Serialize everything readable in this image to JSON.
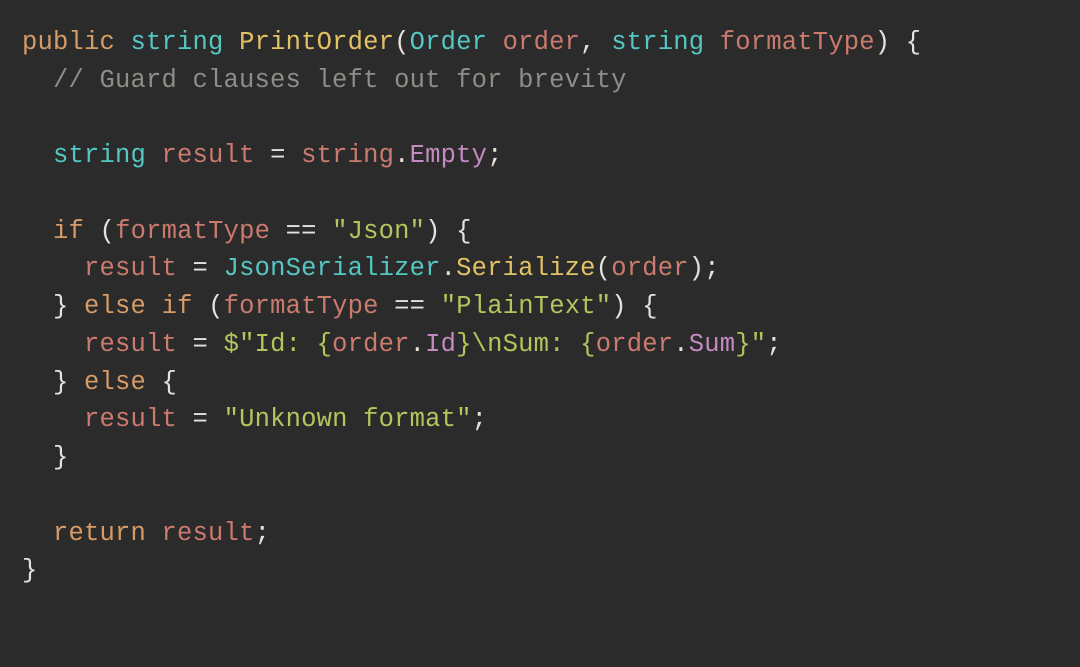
{
  "code": {
    "tokens": {
      "kw_public": "public",
      "kw_string_t": "string",
      "method_name": "PrintOrder",
      "type_order": "Order",
      "param_order": "order",
      "param_ft": "formatType",
      "comment_guard": "// Guard clauses left out for brevity",
      "var_result": "result",
      "ident_string": "string",
      "prop_empty": "Empty",
      "kw_if": "if",
      "op_eqeq": "==",
      "str_json": "\"Json\"",
      "cls_serializer": "JsonSerializer",
      "fn_serialize": "Serialize",
      "kw_else": "else",
      "str_plaintext": "\"PlainText\"",
      "interp_prefix": "$\"Id: {",
      "prop_id": "Id",
      "interp_mid": "}\\nSum: {",
      "prop_sum": "Sum",
      "interp_suffix": "}\"",
      "str_unknown": "\"Unknown format\"",
      "kw_return": "return"
    }
  }
}
